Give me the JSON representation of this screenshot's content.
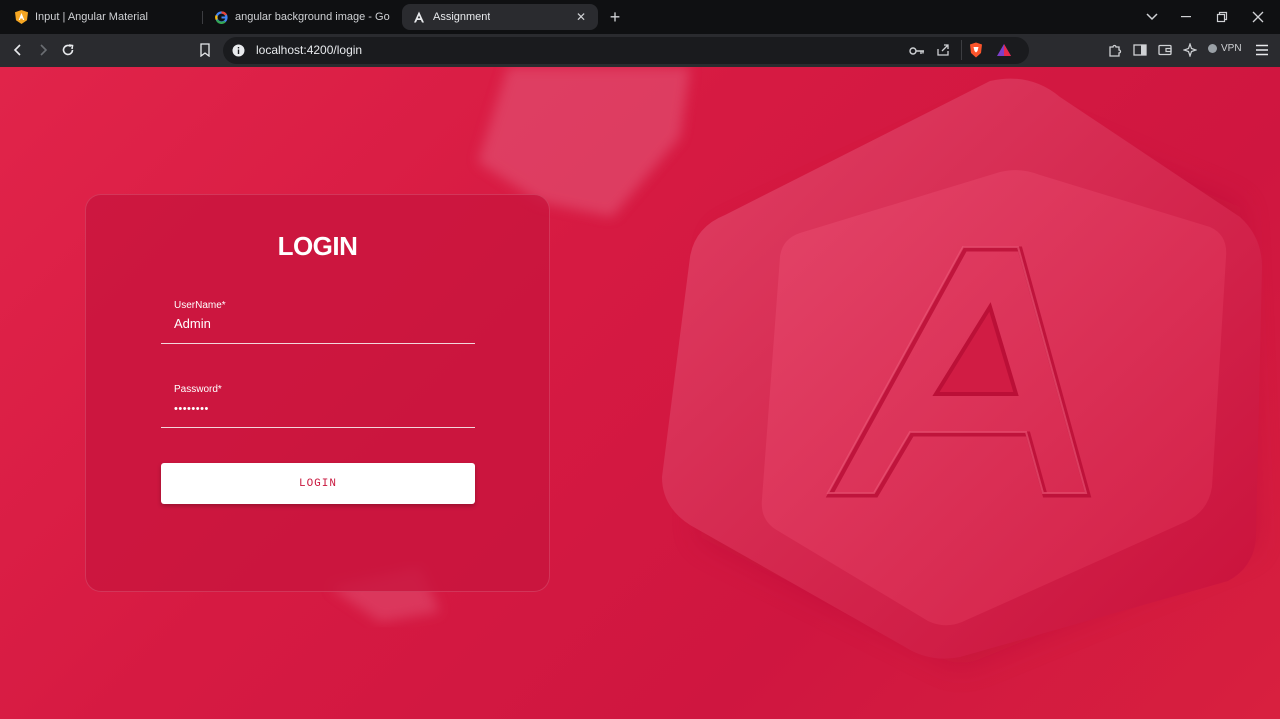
{
  "browser": {
    "tabs": [
      {
        "title": "Input | Angular Material",
        "active": false,
        "favicon": "angular-material-shield-icon"
      },
      {
        "title": "angular background image - Google",
        "active": false,
        "favicon": "google-g-icon"
      },
      {
        "title": "Assignment",
        "active": true,
        "favicon": "angular-a-icon"
      }
    ],
    "url": "localhost:4200/login",
    "vpn_label": "VPN"
  },
  "login": {
    "title": "LOGIN",
    "username_label": "UserName*",
    "username_value": "Admin",
    "password_label": "Password*",
    "password_value": "••••••••",
    "button_label": "LOGIN"
  },
  "colors": {
    "brand_red": "#d61a42",
    "card": "#c8143e",
    "button_text": "#c8153c"
  }
}
